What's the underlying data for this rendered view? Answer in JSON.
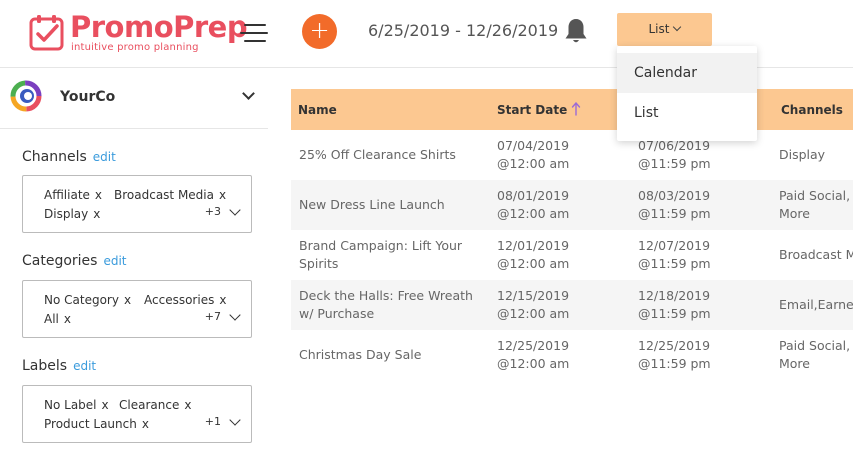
{
  "brand": {
    "name": "PromoPrep",
    "tagline": "intuitive promo planning",
    "accent": "#e94f5f",
    "add_color": "#f26b2a",
    "header_color": "#fcc891"
  },
  "header": {
    "add_label": "+",
    "date_range": "6/25/2019 - 12/26/2019",
    "view_selected": "List",
    "view_options": [
      "Calendar",
      "List"
    ]
  },
  "sidebar": {
    "company": "YourCo",
    "filters": {
      "channels": {
        "label": "Channels",
        "edit": "edit",
        "tags": [
          "Affiliate",
          "Broadcast Media",
          "Display"
        ],
        "more": "+3"
      },
      "categories": {
        "label": "Categories",
        "edit": "edit",
        "tags": [
          "No Category",
          "Accessories",
          "All"
        ],
        "more": "+7"
      },
      "labels": {
        "label": "Labels",
        "edit": "edit",
        "tags": [
          "No Label",
          "Clearance",
          "Product Launch"
        ],
        "more": "+1"
      }
    },
    "remove_glyph": "x"
  },
  "table": {
    "columns": [
      "Name",
      "Start Date",
      "Channels"
    ],
    "sorted_by": "Start Date",
    "sort_direction": "ascending",
    "rows": [
      {
        "name1": "25% Off Clearance Shirts",
        "name2": "",
        "start1": "07/04/2019",
        "start2": "@12:00 am",
        "end1": "07/06/2019",
        "end2": "@11:59 pm",
        "channels1": "Display",
        "channels2": ""
      },
      {
        "name1": "New Dress Line Launch",
        "name2": "",
        "start1": "08/01/2019",
        "start2": "@12:00 am",
        "end1": "08/03/2019",
        "end2": "@11:59 pm",
        "channels1": "Paid Social, E",
        "channels2": "More"
      },
      {
        "name1": "Brand Campaign: Lift Your",
        "name2": "Spirits",
        "start1": "12/01/2019",
        "start2": "@12:00 am",
        "end1": "12/07/2019",
        "end2": "@11:59 pm",
        "channels1": "Broadcast M",
        "channels2": ""
      },
      {
        "name1": "Deck the Halls: Free Wreath",
        "name2": "w/ Purchase",
        "start1": "12/15/2019",
        "start2": "@12:00 am",
        "end1": "12/18/2019",
        "end2": "@11:59 pm",
        "channels1": "Email,Earned",
        "channels2": ""
      },
      {
        "name1": "Christmas Day Sale",
        "name2": "",
        "start1": "12/25/2019",
        "start2": "@12:00 am",
        "end1": "12/25/2019",
        "end2": "@11:59 pm",
        "channels1": "Paid Social, A",
        "channels2": "More"
      }
    ]
  },
  "icons": [
    "app-logo-icon",
    "hamburger-icon",
    "bell-icon",
    "company-logo-icon",
    "sort-up-arrow-icon",
    "chevron-down-icon"
  ]
}
